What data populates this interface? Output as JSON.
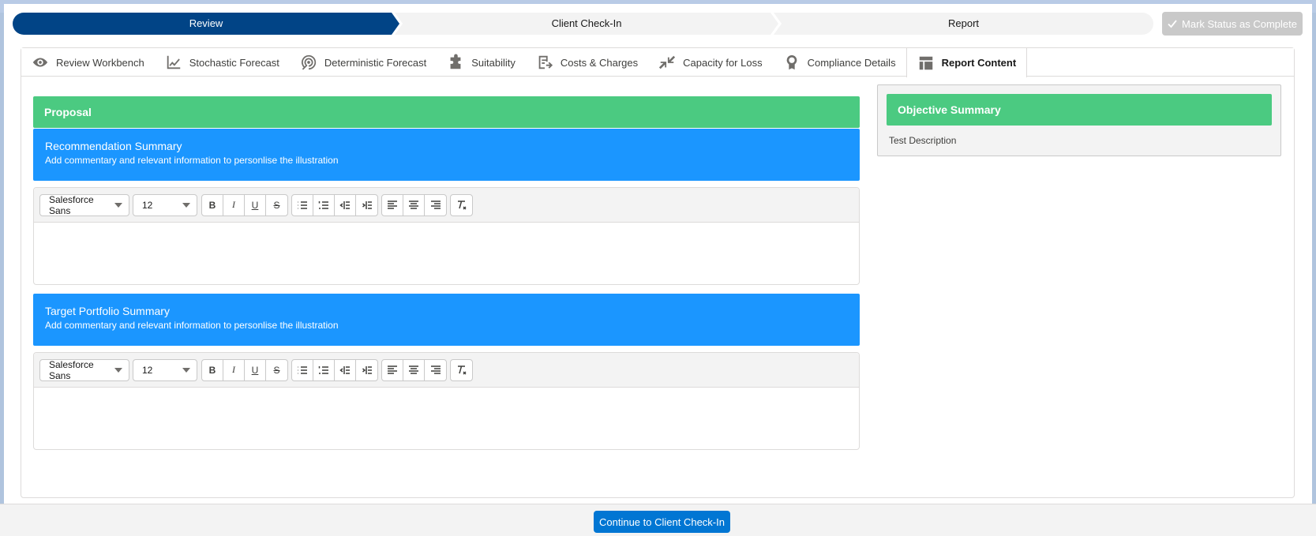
{
  "path": {
    "steps": [
      "Review",
      "Client Check-In",
      "Report"
    ],
    "active_step": "Review",
    "complete_button_label": "Mark Status as Complete"
  },
  "tabs": [
    {
      "label": "Review Workbench",
      "icon": "eye-icon"
    },
    {
      "label": "Stochastic Forecast",
      "icon": "line-chart-icon"
    },
    {
      "label": "Deterministic Forecast",
      "icon": "target-icon"
    },
    {
      "label": "Suitability",
      "icon": "puzzle-icon"
    },
    {
      "label": "Costs & Charges",
      "icon": "document-arrow-icon"
    },
    {
      "label": "Capacity for Loss",
      "icon": "contract-arrows-icon"
    },
    {
      "label": "Compliance Details",
      "icon": "award-icon"
    },
    {
      "label": "Report Content",
      "icon": "layout-icon"
    }
  ],
  "active_tab": "Report Content",
  "proposal": {
    "title": "Proposal"
  },
  "sections": [
    {
      "title": "Recommendation Summary",
      "description": "Add commentary and relevant information to personlise the illustration",
      "editor": {
        "font": "Salesforce Sans",
        "size": "12",
        "content": ""
      }
    },
    {
      "title": "Target Portfolio Summary",
      "description": "Add commentary and relevant information to personlise the illustration",
      "editor": {
        "font": "Salesforce Sans",
        "size": "12",
        "content": ""
      }
    }
  ],
  "objective": {
    "title": "Objective Summary",
    "description": "Test Description"
  },
  "footer": {
    "continue_label": "Continue to Client Check-In"
  },
  "colors": {
    "path_active": "#014486",
    "green_header": "#4bca81",
    "blue_header": "#1b96ff",
    "brand_button": "#0176d3",
    "disabled_button": "#c9c9c9"
  }
}
